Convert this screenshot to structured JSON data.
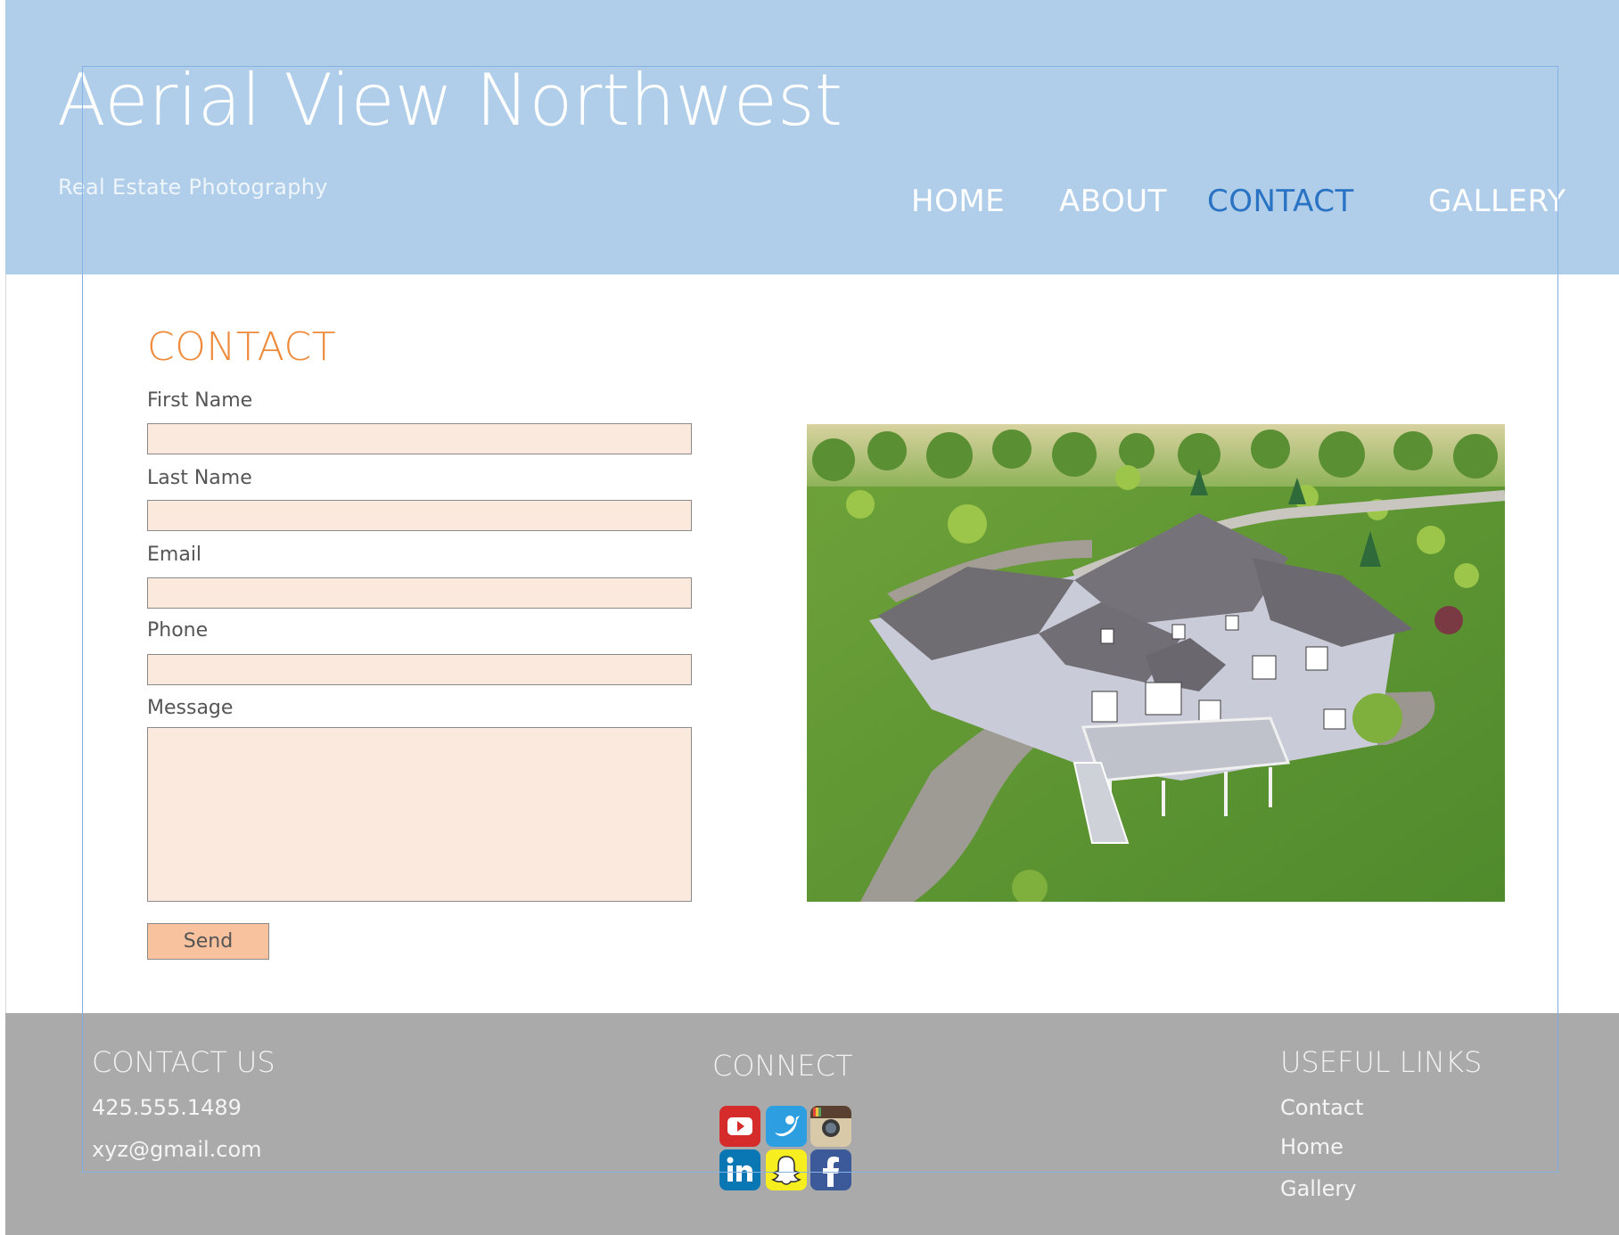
{
  "header": {
    "site_title": "Aerial View Northwest",
    "tagline": "Real Estate Photography",
    "nav": [
      {
        "label": "HOME"
      },
      {
        "label": "ABOUT"
      },
      {
        "label": "CONTACT",
        "active": true
      },
      {
        "label": "GALLERY"
      }
    ]
  },
  "contact_form": {
    "heading": "CONTACT",
    "fields": {
      "first_name": {
        "label": "First Name",
        "value": ""
      },
      "last_name": {
        "label": "Last Name",
        "value": ""
      },
      "email": {
        "label": "Email",
        "value": ""
      },
      "phone": {
        "label": "Phone",
        "value": ""
      },
      "message": {
        "label": "Message",
        "value": ""
      }
    },
    "send_label": "Send"
  },
  "photo": {
    "subject": "aerial view of a large house with green lawn"
  },
  "footer": {
    "contact": {
      "heading": "CONTACT US",
      "phone": "425.555.1489",
      "email": "xyz@gmail.com"
    },
    "connect": {
      "heading": "CONNECT",
      "icons": [
        "youtube-icon",
        "twitter-icon",
        "instagram-icon",
        "linkedin-icon",
        "snapchat-icon",
        "facebook-icon"
      ]
    },
    "links": {
      "heading": "USEFUL LINKS",
      "items": [
        {
          "label": "Contact"
        },
        {
          "label": "Home"
        },
        {
          "label": "Gallery"
        }
      ]
    }
  },
  "colors": {
    "header_bg": "#b0cee9",
    "accent_orange": "#ee8a3a",
    "nav_active": "#2a73c4",
    "input_bg": "#fce9de",
    "button_bg": "#f9c29f",
    "footer_bg": "#aaaaaa"
  }
}
